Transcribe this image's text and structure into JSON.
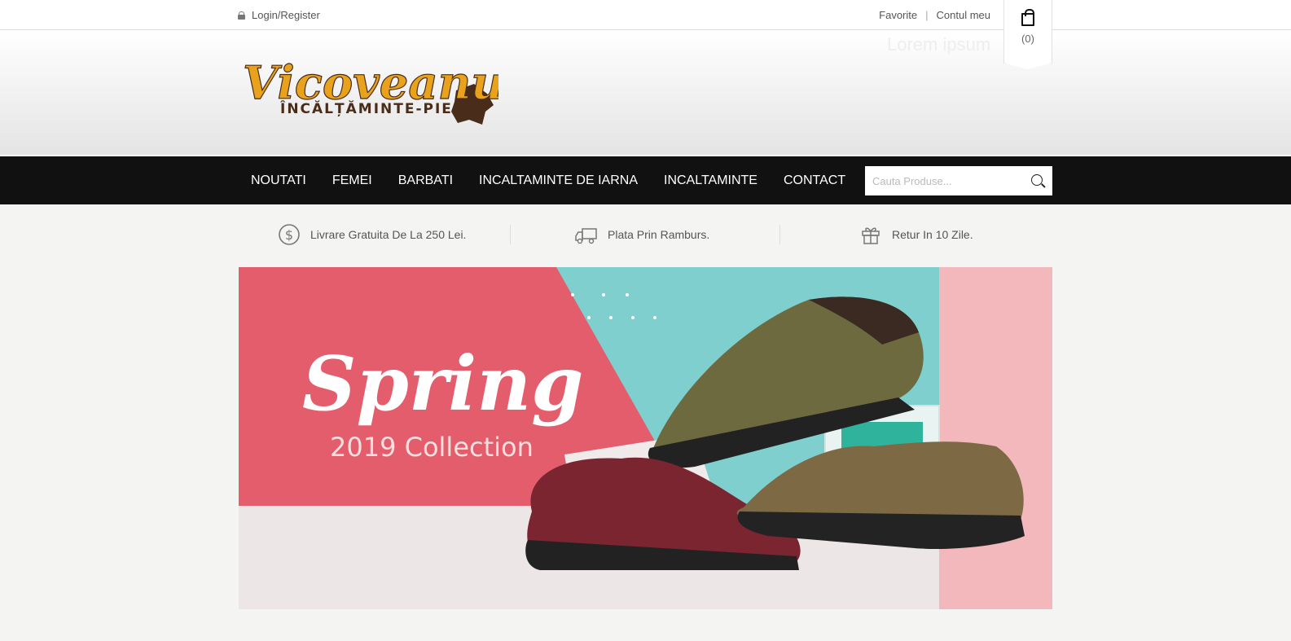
{
  "topbar": {
    "login_label": "Login/Register",
    "favorites_label": "Favorite",
    "separator": "|",
    "account_label": "Contul meu",
    "cart_count": "(0)",
    "faded_text": "Lorem ipsum"
  },
  "header": {
    "logo_text": "Vicoveanu",
    "logo_subtitle": "ÎNCĂLȚĂMINTE-PIELE"
  },
  "nav": {
    "items": [
      {
        "label": "NOUTATI"
      },
      {
        "label": "FEMEI"
      },
      {
        "label": "BARBATI"
      },
      {
        "label": "INCALTAMINTE DE IARNA"
      },
      {
        "label": "INCALTAMINTE"
      },
      {
        "label": "CONTACT"
      }
    ],
    "search_placeholder": "Cauta Produse..."
  },
  "features": [
    {
      "label": "Livrare Gratuita De La 250 Lei.",
      "icon": "dollar-icon"
    },
    {
      "label": "Plata Prin Ramburs.",
      "icon": "truck-icon"
    },
    {
      "label": "Retur In 10 Zile.",
      "icon": "gift-icon"
    }
  ],
  "banner": {
    "headline": "Spring",
    "subline": "2019 Collection"
  },
  "colors": {
    "nav_bg": "#111111",
    "logo_orange": "#e9a21c",
    "logo_brown": "#4a2c1a",
    "banner_pink": "#e45d6c",
    "banner_teal": "#7fcfcf"
  }
}
